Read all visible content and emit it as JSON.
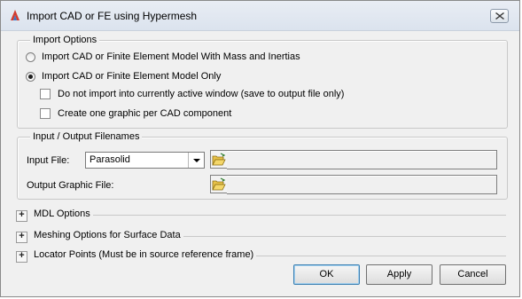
{
  "window": {
    "title": "Import CAD or FE using Hypermesh"
  },
  "import_options": {
    "legend": "Import Options",
    "radio_mass": "Import CAD or Finite Element Model With Mass and Inertias",
    "radio_only": "Import CAD or Finite Element Model Only",
    "check_no_import": "Do not import into currently active window (save to output file only)",
    "check_graphic": "Create one graphic per CAD component",
    "selected": "radio_only"
  },
  "filenames": {
    "legend": "Input / Output Filenames",
    "input_label": "Input File:",
    "input_format": "Parasolid",
    "input_path": "",
    "output_label": "Output Graphic File:",
    "output_path": ""
  },
  "sections": [
    {
      "label": "MDL Options"
    },
    {
      "label": "Meshing Options for Surface Data"
    },
    {
      "label": "Locator Points (Must be in source reference frame)"
    }
  ],
  "buttons": {
    "ok": "OK",
    "apply": "Apply",
    "cancel": "Cancel"
  },
  "icons": {
    "app": "altair-logo-icon",
    "folder": "folder-open-icon",
    "close": "close-icon"
  }
}
